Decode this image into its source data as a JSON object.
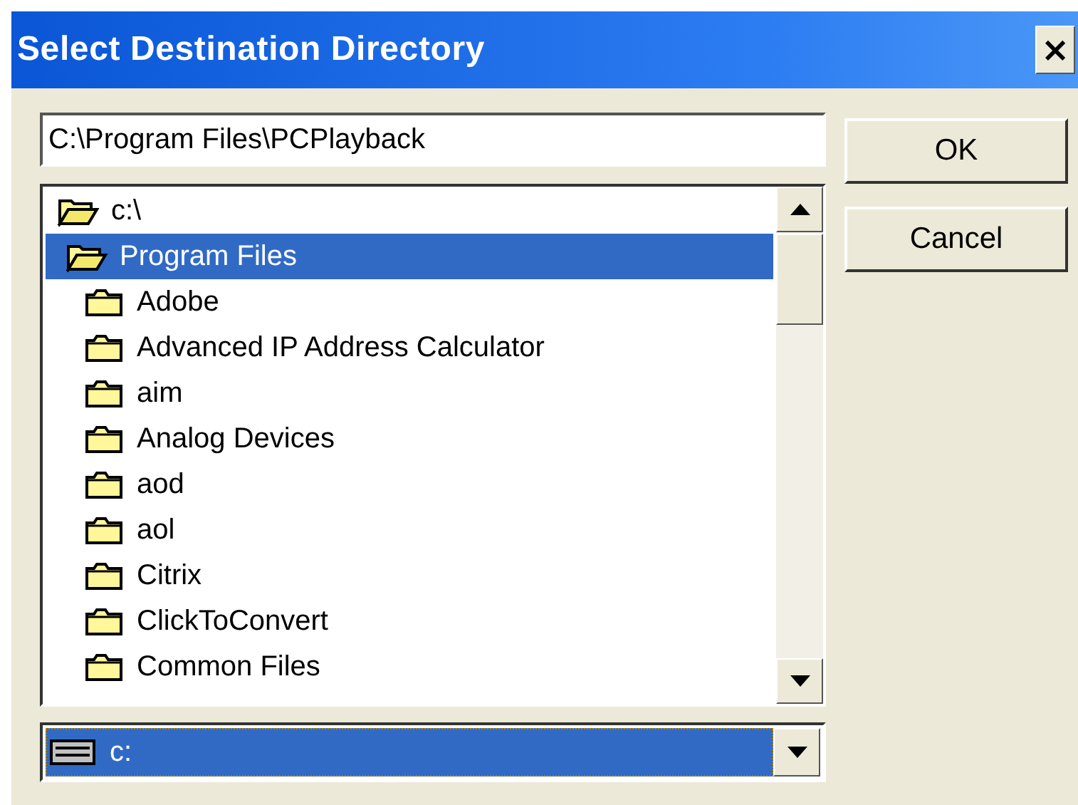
{
  "window": {
    "title": "Select Destination Directory",
    "close": "×"
  },
  "path_field": {
    "value": "C:\\Program Files\\PCPlayback"
  },
  "tree": [
    {
      "label": "c:\\",
      "expanded": true,
      "selected": false,
      "children": [
        {
          "label": "Program Files",
          "expanded": true,
          "selected": true,
          "children": [
            {
              "label": "Adobe",
              "expanded": false,
              "selected": false
            },
            {
              "label": "Advanced IP Address Calculator",
              "expanded": false,
              "selected": false
            },
            {
              "label": "aim",
              "expanded": false,
              "selected": false
            },
            {
              "label": "Analog Devices",
              "expanded": false,
              "selected": false
            },
            {
              "label": "aod",
              "expanded": false,
              "selected": false
            },
            {
              "label": "aol",
              "expanded": false,
              "selected": false
            },
            {
              "label": "Citrix",
              "expanded": false,
              "selected": false
            },
            {
              "label": "ClickToConvert",
              "expanded": false,
              "selected": false
            },
            {
              "label": "Common Files",
              "expanded": false,
              "selected": false
            }
          ]
        }
      ]
    }
  ],
  "drive": {
    "value": "c:"
  },
  "buttons": [
    {
      "label": "OK"
    },
    {
      "label": "Cancel"
    }
  ]
}
